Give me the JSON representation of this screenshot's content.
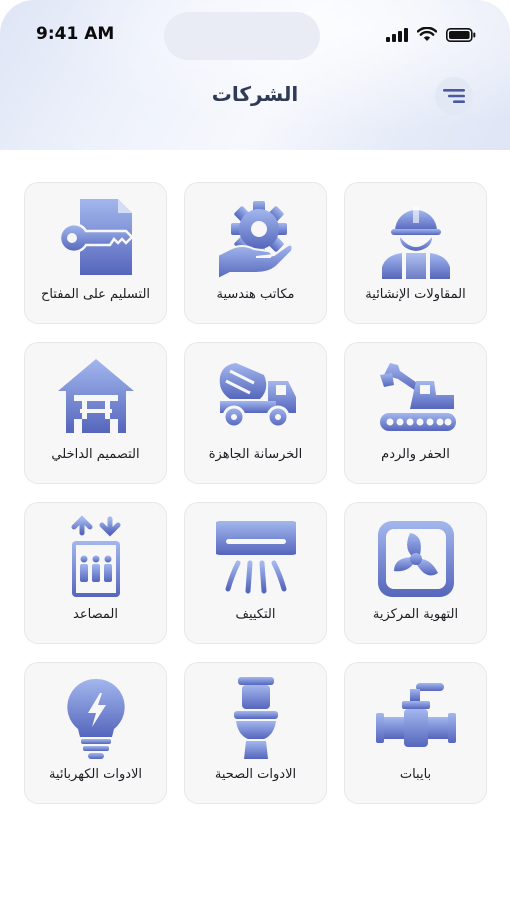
{
  "status_bar": {
    "time": "9:41 AM"
  },
  "header": {
    "title": "الشركات",
    "menu_icon": "filter-menu-icon"
  },
  "accent_gradient": [
    "#a3b7ee",
    "#5566bc"
  ],
  "categories": [
    {
      "label": "المقاولات الإنشائية",
      "icon": "construction-worker-icon"
    },
    {
      "label": "مكاتب هندسية",
      "icon": "engineering-office-icon"
    },
    {
      "label": "التسليم على المفتاح",
      "icon": "turnkey-icon"
    },
    {
      "label": "الحفر والردم",
      "icon": "excavator-icon"
    },
    {
      "label": "الخرسانة الجاهزة",
      "icon": "concrete-mixer-icon"
    },
    {
      "label": "التصميم الداخلي",
      "icon": "interior-design-icon"
    },
    {
      "label": "التهوية المركزية",
      "icon": "ventilation-fan-icon"
    },
    {
      "label": "التكييف",
      "icon": "air-conditioner-icon"
    },
    {
      "label": "المصاعد",
      "icon": "elevator-icon"
    },
    {
      "label": "بايبات",
      "icon": "pipes-icon"
    },
    {
      "label": "الادوات الصحية",
      "icon": "toilet-icon"
    },
    {
      "label": "الادوات الكهربائية",
      "icon": "light-bulb-icon"
    }
  ]
}
